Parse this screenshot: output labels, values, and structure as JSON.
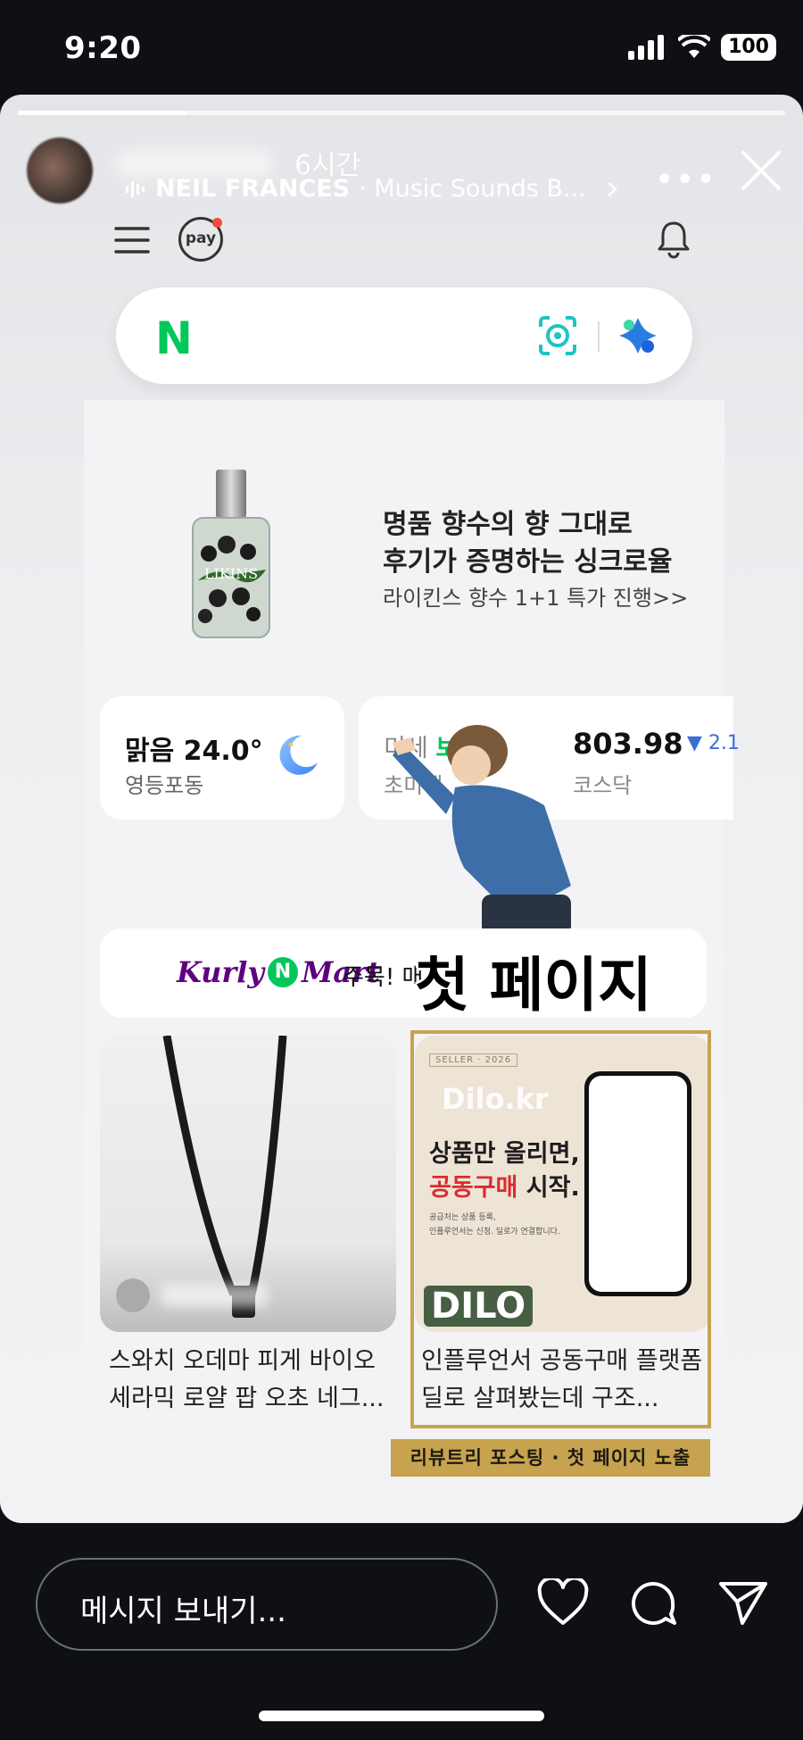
{
  "status_bar": {
    "time": "9:20",
    "battery": "100"
  },
  "story": {
    "progress": 0.22,
    "time_ago": "6시간",
    "music_artist": "NEIL FRANCES",
    "music_track": "· Music Sounds B..."
  },
  "naver": {
    "search_logo": "N",
    "pay_label": "pay",
    "ad": {
      "line1": "명품 향수의 향 그대로",
      "line2": "후기가 증명하는 싱크로율",
      "line3": "라이킨스 향수 1+1 특가 진행>>",
      "bottle_label": "LIKINS"
    },
    "weather": {
      "title": "맑음 24.0°",
      "location": "영등포동"
    },
    "stock": {
      "left_prefix": "미세",
      "left_status": "보통",
      "left_sub": "초미세",
      "value": "803.98",
      "change": "▼ 2.1",
      "market": "코스닥"
    },
    "kurly": {
      "logo_left": "Kurly",
      "logo_n": "N",
      "logo_right": "Mart",
      "text": "주목! 매"
    },
    "cards": [
      {
        "title": "스와치 오데마 피게 바이오 세라믹 로얄 팝 오초 네그..."
      },
      {
        "title": "인플루언서 공동구매 플랫폼 딜로 살펴봤는데 구조...",
        "seller": "SELLER · 2026",
        "brand": "Dilo.kr",
        "headline1": "상품만 올리면,",
        "headline2_red": "공동구매",
        "headline2_rest": " 시작.",
        "sub1": "공급처는 상품 등록,",
        "sub2": "인플루언서는 신청. 딜로가 연결합니다.",
        "badge": "DILO"
      }
    ]
  },
  "overlay": {
    "sticker_text": "첫 페이지",
    "tag": "리뷰트리 포스팅 · 첫 페이지 노출"
  },
  "bottom": {
    "message_placeholder": "메시지 보내기..."
  }
}
